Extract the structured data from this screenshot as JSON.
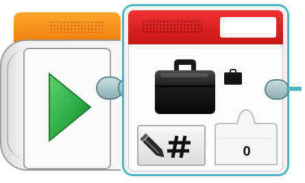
{
  "start_block": {
    "header_color": "#f58a18",
    "play_icon": "play-triangle-icon",
    "play_color": "#2eac46"
  },
  "loop_block": {
    "header_color": "#e02323",
    "border_color": "#49b7c0",
    "loop_name": "",
    "main_icon": "briefcase-icon",
    "small_icon": "small-briefcase-icon",
    "mode_icon": "pencil-hash-icon",
    "count": {
      "value": "0"
    }
  }
}
